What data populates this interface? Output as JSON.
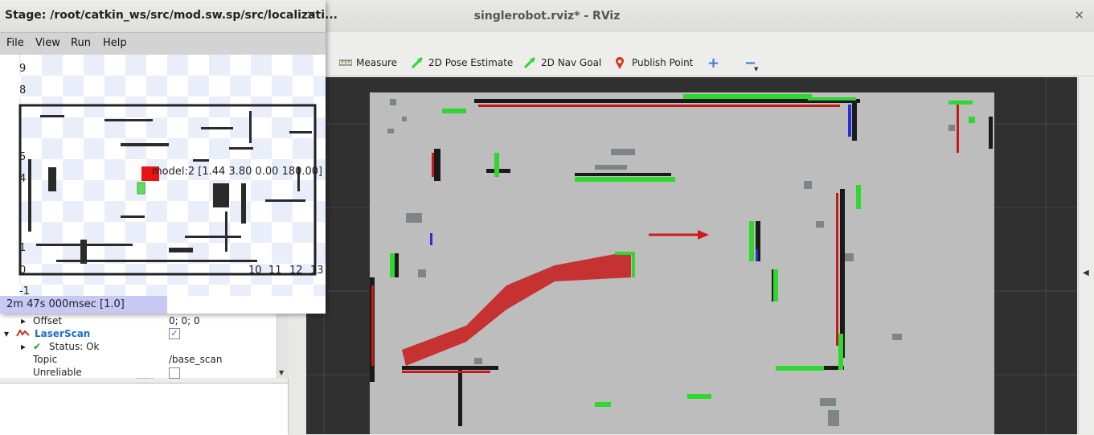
{
  "rviz": {
    "title": "singlerobot.rviz* - RViz",
    "close_glyph": "✕",
    "toolbar": {
      "measure": "Measure",
      "pose_estimate": "2D Pose Estimate",
      "nav_goal": "2D Nav Goal",
      "publish_point": "Publish Point",
      "zoom_in": "+",
      "zoom_out": "−"
    },
    "colors": {
      "accent_green": "#2fd72f",
      "pin_red": "#d33a1c",
      "plus_blue": "#3b7bd6"
    }
  },
  "displays": {
    "rows": [
      {
        "label": "Offset",
        "value": "0; 0; 0"
      },
      {
        "label": "LaserScan",
        "value": "✓"
      },
      {
        "label": "Status: Ok",
        "value": ""
      },
      {
        "label": "Topic",
        "value": "/base_scan"
      },
      {
        "label": "Unreliable",
        "value": ""
      }
    ]
  },
  "stage": {
    "title": "Stage: /root/catkin_ws/src/mod.sw.sp/src/localizati...",
    "close_glyph": "✕",
    "menu": [
      "File",
      "View",
      "Run",
      "Help"
    ],
    "y_ticks": [
      "9",
      "8",
      "5",
      "4",
      "1",
      "0",
      "-1"
    ],
    "x_ticks": [
      "10",
      "11",
      "12",
      "13"
    ],
    "model_label": "model:2 [1.44 3.80 0.00 180.00]",
    "status": "2m 47s 000msec [1.0]"
  }
}
